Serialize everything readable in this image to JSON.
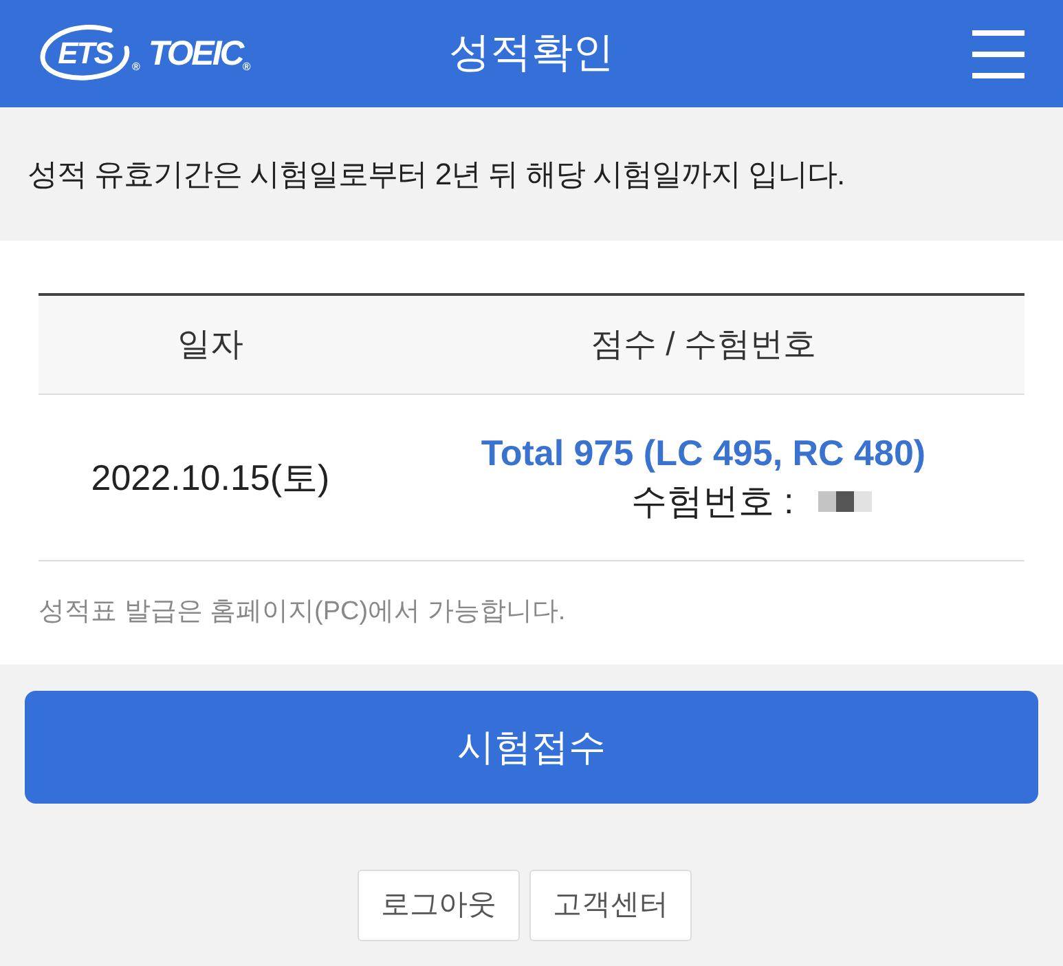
{
  "header": {
    "logo": {
      "mark_text": "ETS",
      "mark_symbol": "®",
      "wordmark": "TOEIC",
      "wordmark_symbol": "®"
    },
    "title": "성적확인"
  },
  "notice": "성적 유효기간은 시험일로부터 2년 뒤 해당 시험일까지 입니다.",
  "table": {
    "columns": [
      "일자",
      "점수 / 수험번호"
    ],
    "rows": [
      {
        "date": "2022.10.15(토)",
        "score": "Total 975 (LC 495, RC 480)",
        "exam_number_label": "수험번호 :",
        "exam_number_redacted": true
      }
    ]
  },
  "footnote": "성적표 발급은 홈페이지(PC)에서 가능합니다.",
  "primary_button": "시험접수",
  "links": [
    "로그아웃",
    "고객센터"
  ]
}
